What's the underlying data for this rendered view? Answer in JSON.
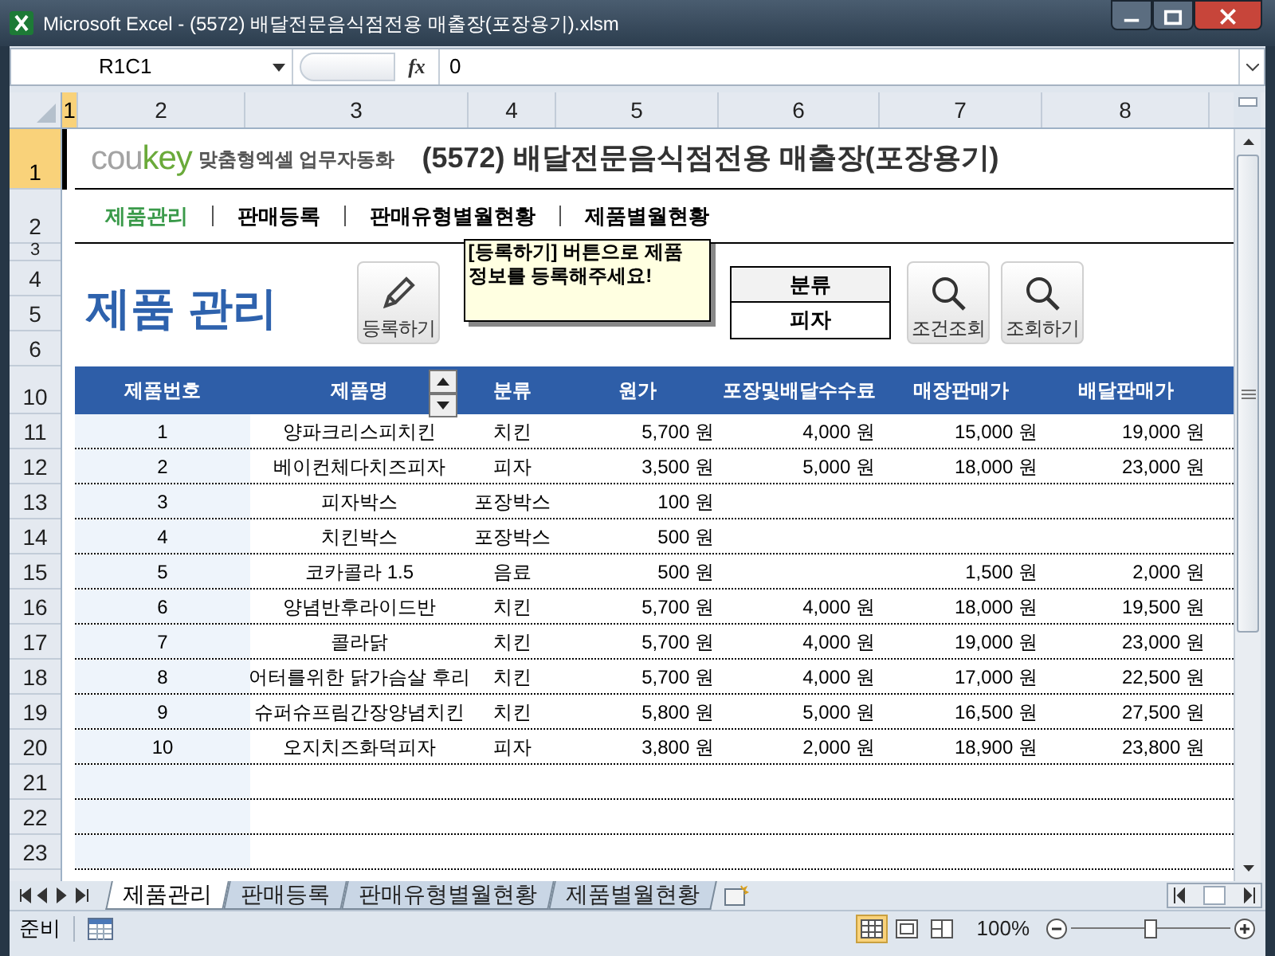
{
  "window": {
    "title": "Microsoft Excel - (5572) 배달전문음식점전용 매출장(포장용기).xlsm"
  },
  "formula_bar": {
    "name_box": "R1C1",
    "fx": "fx",
    "formula": "0"
  },
  "column_headers": [
    {
      "label": "1",
      "selected": true
    },
    {
      "label": "2",
      "selected": false
    },
    {
      "label": "3",
      "selected": false
    },
    {
      "label": "4",
      "selected": false
    },
    {
      "label": "5",
      "selected": false
    },
    {
      "label": "6",
      "selected": false
    },
    {
      "label": "7",
      "selected": false
    },
    {
      "label": "8",
      "selected": false
    }
  ],
  "row_headers": [
    {
      "label": "1",
      "selected": true
    },
    {
      "label": "2",
      "selected": false
    },
    {
      "label": "3",
      "selected": false
    },
    {
      "label": "4",
      "selected": false
    },
    {
      "label": "5",
      "selected": false
    },
    {
      "label": "6",
      "selected": false
    },
    {
      "label": "10",
      "selected": false
    },
    {
      "label": "11",
      "selected": false
    },
    {
      "label": "12",
      "selected": false
    },
    {
      "label": "13",
      "selected": false
    },
    {
      "label": "14",
      "selected": false
    },
    {
      "label": "15",
      "selected": false
    },
    {
      "label": "16",
      "selected": false
    },
    {
      "label": "17",
      "selected": false
    },
    {
      "label": "18",
      "selected": false
    },
    {
      "label": "19",
      "selected": false
    },
    {
      "label": "20",
      "selected": false
    },
    {
      "label": "21",
      "selected": false
    },
    {
      "label": "22",
      "selected": false
    },
    {
      "label": "23",
      "selected": false
    }
  ],
  "sheet": {
    "logo_parts": [
      {
        "text": "cou",
        "color": "#a3a3a3"
      },
      {
        "text": "key",
        "color": "#6aaa3a"
      }
    ],
    "tagline": "맞춤형엑셀 업무자동화",
    "title": "(5572) 배달전문음식점전용 매출장(포장용기)",
    "nav": [
      {
        "label": "제품관리",
        "selected": true
      },
      {
        "label": "판매등록",
        "selected": false
      },
      {
        "label": "판매유형별월현황",
        "selected": false
      },
      {
        "label": "제품별월현황",
        "selected": false
      }
    ],
    "heading": "제품 관리",
    "register_button": "등록하기",
    "comment": "[등록하기] 버튼으로 제품 정보를 등록해주세요!",
    "filter": {
      "label": "분류",
      "value": "피자"
    },
    "search_buttons": [
      "조건조회",
      "조회하기"
    ],
    "table": {
      "columns": [
        "제품번호",
        "제품명",
        "분류",
        "원가",
        "포장및배달수수료",
        "매장판매가",
        "배달판매가"
      ],
      "rows": [
        [
          "1",
          "양파크리스피치킨",
          "치킨",
          "5,700 원",
          "4,000 원",
          "15,000 원",
          "19,000 원"
        ],
        [
          "2",
          "베이컨체다치즈피자",
          "피자",
          "3,500 원",
          "5,000 원",
          "18,000 원",
          "23,000 원"
        ],
        [
          "3",
          "피자박스",
          "포장박스",
          "100 원",
          "",
          "",
          ""
        ],
        [
          "4",
          "치킨박스",
          "포장박스",
          "500 원",
          "",
          "",
          ""
        ],
        [
          "5",
          "코카콜라 1.5",
          "음료",
          "500 원",
          "",
          "1,500 원",
          "2,000 원"
        ],
        [
          "6",
          "양념반후라이드반",
          "치킨",
          "5,700 원",
          "4,000 원",
          "18,000 원",
          "19,500 원"
        ],
        [
          "7",
          "콜라닭",
          "치킨",
          "5,700 원",
          "4,000 원",
          "19,000 원",
          "23,000 원"
        ],
        [
          "8",
          "어터를위한 닭가슴살 후리",
          "치킨",
          "5,700 원",
          "4,000 원",
          "17,000 원",
          "22,500 원"
        ],
        [
          "9",
          "슈퍼슈프림간장양념치킨",
          "치킨",
          "5,800 원",
          "5,000 원",
          "16,500 원",
          "27,500 원"
        ],
        [
          "10",
          "오지치즈화덕피자",
          "피자",
          "3,800 원",
          "2,000 원",
          "18,900 원",
          "23,800 원"
        ]
      ]
    }
  },
  "sheet_tabs": [
    {
      "label": "제품관리",
      "selected": true
    },
    {
      "label": "판매등록",
      "selected": false
    },
    {
      "label": "판매유형별월현황",
      "selected": false
    },
    {
      "label": "제품별월현황",
      "selected": false
    }
  ],
  "status_bar": {
    "status": "준비",
    "views": [
      {
        "kind": "normal",
        "selected": true
      },
      {
        "kind": "layout",
        "selected": false
      },
      {
        "kind": "pagebreak",
        "selected": false
      }
    ],
    "zoom": "100%",
    "zoom_level": {
      "level": 0.5
    }
  }
}
